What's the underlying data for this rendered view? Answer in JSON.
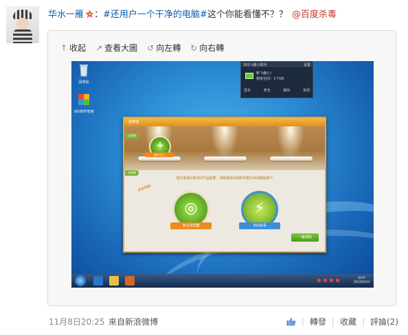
{
  "post": {
    "author": "华水一雁",
    "colon": "：",
    "topic": "#还用户一个干净的电脑#",
    "text": "这个你能看懂不？？",
    "mention": "@百度杀毒"
  },
  "toolbar": {
    "collapse_label": "收起",
    "view_large_label": "查看大圖",
    "rotate_left_label": "向左轉",
    "rotate_right_label": "向右轉"
  },
  "screenshot": {
    "desktop_icons": [
      "回收站",
      "360软件管家"
    ],
    "widget": {
      "title": "360 U盘小助手",
      "settings": "设置",
      "drive": "新飞盘(I:)",
      "free_space": "剩余空间：3.7GB",
      "actions": [
        "显示",
        "安全",
        "弹出",
        "关闭"
      ]
    },
    "dialog": {
      "title": "勋章墙",
      "owned_tag": "已获得",
      "small_medal_label": "安全卫士",
      "unowned_tag": "未获得",
      "notice": "您已获得1枚360产品勋章，领取剩余2枚即可成为360超级用户",
      "stamp": "点击领取",
      "medal_1": "安全浏览器",
      "medal_2": "360杀毒",
      "claim_button": "一键领取"
    },
    "taskbar": {
      "time": "18:07",
      "date": "2013/10/13"
    }
  },
  "footer": {
    "timestamp": "11月8日20:25",
    "source": "來自新浪微博",
    "forward": "轉發",
    "favorite": "收藏",
    "comment": "評論(2)"
  },
  "colors": {
    "link": "#0a5ca8",
    "mention": "#c0392b",
    "dialog_border": "#e9a437",
    "accent_green": "#6ab32c"
  }
}
